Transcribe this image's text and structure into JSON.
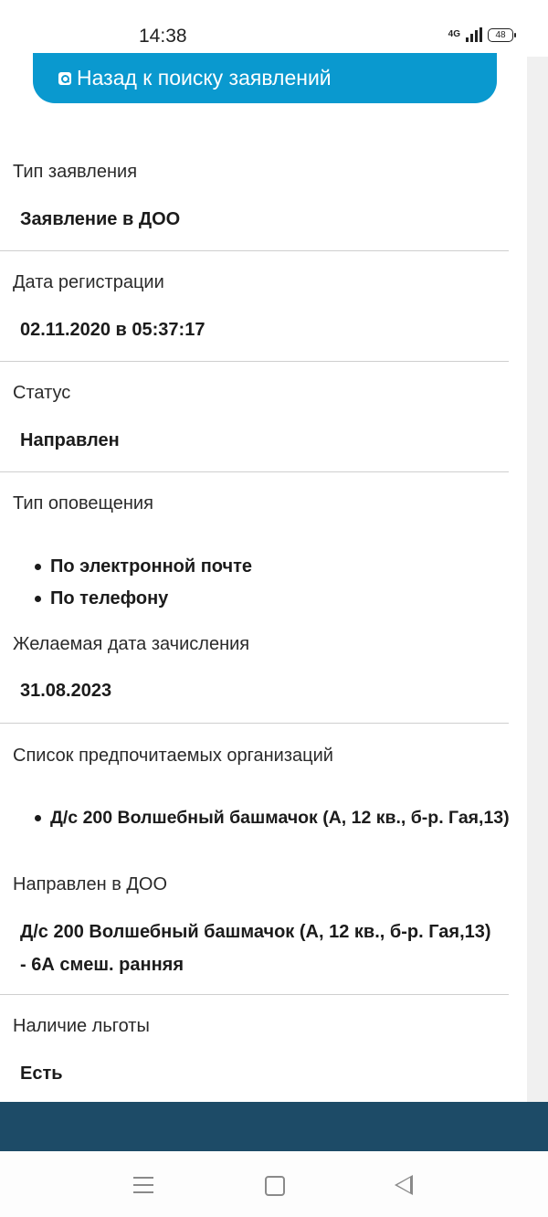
{
  "status_bar": {
    "time": "14:38",
    "network": "4G",
    "battery": "48"
  },
  "back_button": {
    "label": "Назад к поиску заявлений",
    "icon": "search-icon",
    "color": "#0a99cf"
  },
  "fields": {
    "type": {
      "label": "Тип заявления",
      "value": "Заявление в ДОО"
    },
    "reg_date": {
      "label": "Дата регистрации",
      "value": "02.11.2020 в 05:37:17"
    },
    "status": {
      "label": "Статус",
      "value": "Направлен"
    },
    "notify": {
      "label": "Тип оповещения",
      "items": [
        "По электронной почте",
        "По телефону"
      ]
    },
    "desired_date": {
      "label": "Желаемая дата зачисления",
      "value": "31.08.2023"
    },
    "orgs": {
      "label": "Список предпочитаемых организаций",
      "items": [
        "Д/с 200 Волшебный башмачок (А, 12 кв., б-р. Гая,13)"
      ]
    },
    "directed": {
      "label": "Направлен в ДОО",
      "value": "Д/с 200 Волшебный башмачок (А, 12 кв., б-р. Гая,13) - 6А смеш. ранняя"
    },
    "benefit": {
      "label": "Наличие льготы",
      "value": "Есть"
    }
  },
  "theme": {
    "footer_color": "#1d4b67"
  }
}
